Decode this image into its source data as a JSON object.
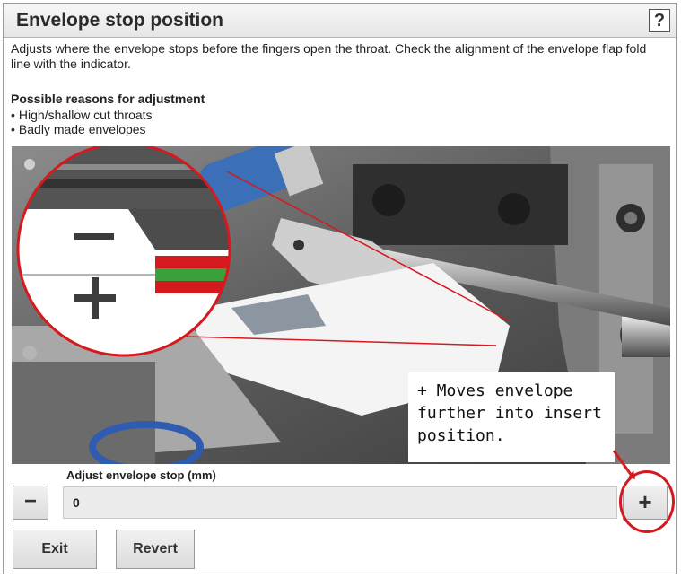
{
  "dialog": {
    "title": "Envelope stop position",
    "help_label": "?",
    "description": "Adjusts where the envelope stops before the fingers open the throat. Check the alignment of the envelope flap fold line with the indicator.",
    "reasons_heading": "Possible reasons for adjustment",
    "reasons": [
      "High/shallow cut throats",
      "Badly made envelopes"
    ]
  },
  "illustration": {
    "minus_symbol": "−",
    "plus_symbol": "+"
  },
  "adjust": {
    "label": "Adjust envelope stop (mm)",
    "minus_label": "−",
    "value": "0",
    "plus_label": "+"
  },
  "footer": {
    "exit_label": "Exit",
    "revert_label": "Revert"
  },
  "annotation": {
    "callout_text": "+ Moves envelope further into insert position.",
    "accent_color": "#d6191f"
  }
}
